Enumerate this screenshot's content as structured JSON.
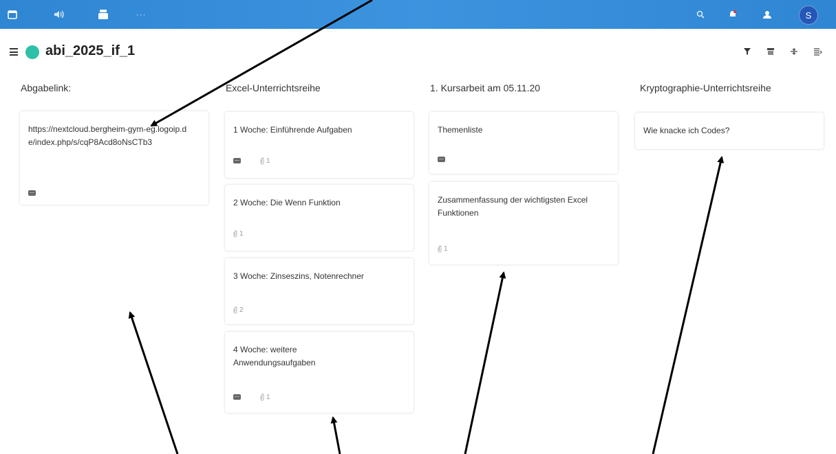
{
  "topbar": {
    "apps": [
      "calendar-icon",
      "audio-icon",
      "deck-icon",
      "more-icon"
    ],
    "right_icons": [
      "search-icon",
      "notifications-icon",
      "contacts-icon"
    ],
    "avatar_initial": "S",
    "accent_color": "#3b8fd9"
  },
  "board": {
    "title": "abi_2025_if_1",
    "color": "#2fc0a8",
    "header_icons": [
      "filter-icon",
      "archive-icon",
      "collapse-icon",
      "details-icon"
    ]
  },
  "stacks": [
    {
      "title": "Abgabelink:",
      "cards": [
        {
          "title": "https://nextcloud.bergheim-gym-eg.logoip.de/index.php/s/cqP8Acd8oNsCTb3",
          "comments": true,
          "attachments": ""
        }
      ]
    },
    {
      "title": "Excel-Unterrichtsreihe",
      "cards": [
        {
          "title": "1 Woche: Einführende Aufgaben",
          "comments": true,
          "attachments": "1"
        },
        {
          "title": "2 Woche: Die Wenn Funktion",
          "comments": false,
          "attachments": "1"
        },
        {
          "title": "3 Woche: Zinseszins, Notenrechner",
          "comments": false,
          "attachments": "2"
        },
        {
          "title": "4 Woche: weitere Anwendungsaufgaben",
          "comments": true,
          "attachments": "1"
        }
      ]
    },
    {
      "title": "1. Kursarbeit am 05.11.20",
      "cards": [
        {
          "title": "Themenliste",
          "comments": true,
          "attachments": ""
        },
        {
          "title": "Zusammenfassung der wichtigsten Excel Funktionen",
          "comments": false,
          "attachments": "1"
        }
      ]
    },
    {
      "title": "Kryptographie-Unterrichtsreihe",
      "cards": [
        {
          "title": "Wie knacke ich Codes?",
          "comments": false,
          "attachments": ""
        }
      ]
    }
  ]
}
